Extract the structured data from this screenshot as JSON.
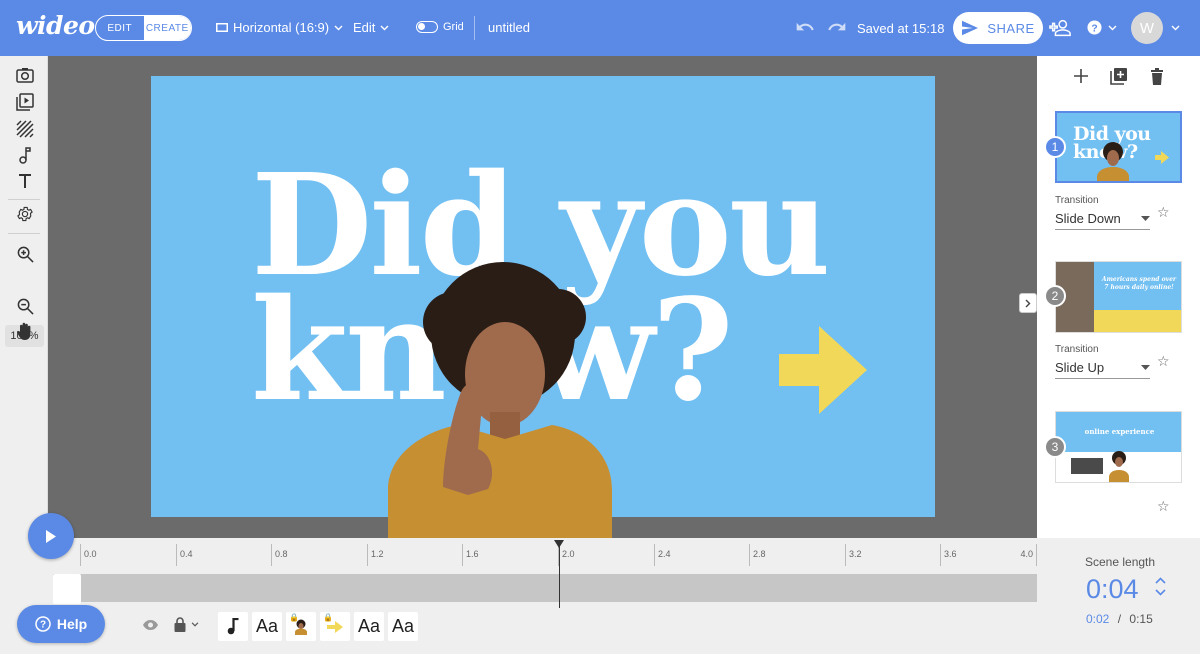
{
  "header": {
    "logo": "wideo",
    "mode_edit": "EDIT",
    "mode_create": "CREATE",
    "format": "Horizontal (16:9)",
    "edit_menu": "Edit",
    "grid_label": "Grid",
    "title": "untitled",
    "saved_status": "Saved at 15:18",
    "share_label": "SHARE",
    "avatar_initial": "W"
  },
  "left_tools": {
    "zoom_level": "100%"
  },
  "slide": {
    "line1": "Did you",
    "line2": "know?",
    "background": "#72bff2",
    "arrow_color": "#f2d859"
  },
  "scenes": [
    {
      "number": "1",
      "transition_label": "Transition",
      "transition_value": "Slide Down",
      "thumb_text": "Did you know?"
    },
    {
      "number": "2",
      "transition_label": "Transition",
      "transition_value": "Slide Up",
      "thumb_text": "Americans spend over 7 hours daily online!"
    },
    {
      "number": "3",
      "thumb_text": "online experience"
    }
  ],
  "timeline": {
    "ticks": [
      "0.0",
      "0.4",
      "0.8",
      "1.2",
      "1.6",
      "2.0",
      "2.4",
      "2.8",
      "3.2",
      "3.6",
      "4.0"
    ],
    "scene_length_label": "Scene length",
    "scene_length": "0:04",
    "current_time": "0:02",
    "separator": "/",
    "total_time": "0:15"
  },
  "bottom": {
    "help_label": "Help",
    "layers": [
      {
        "type": "audio",
        "label": ""
      },
      {
        "type": "text",
        "label": "Aa"
      },
      {
        "type": "image-locked",
        "label": ""
      },
      {
        "type": "arrow-locked",
        "label": ""
      },
      {
        "type": "text",
        "label": "Aa"
      },
      {
        "type": "text",
        "label": "Aa"
      }
    ]
  },
  "colors": {
    "accent": "#5b8ae6",
    "canvas_bg": "#6b6b6b",
    "panel_bg": "#efefef"
  }
}
